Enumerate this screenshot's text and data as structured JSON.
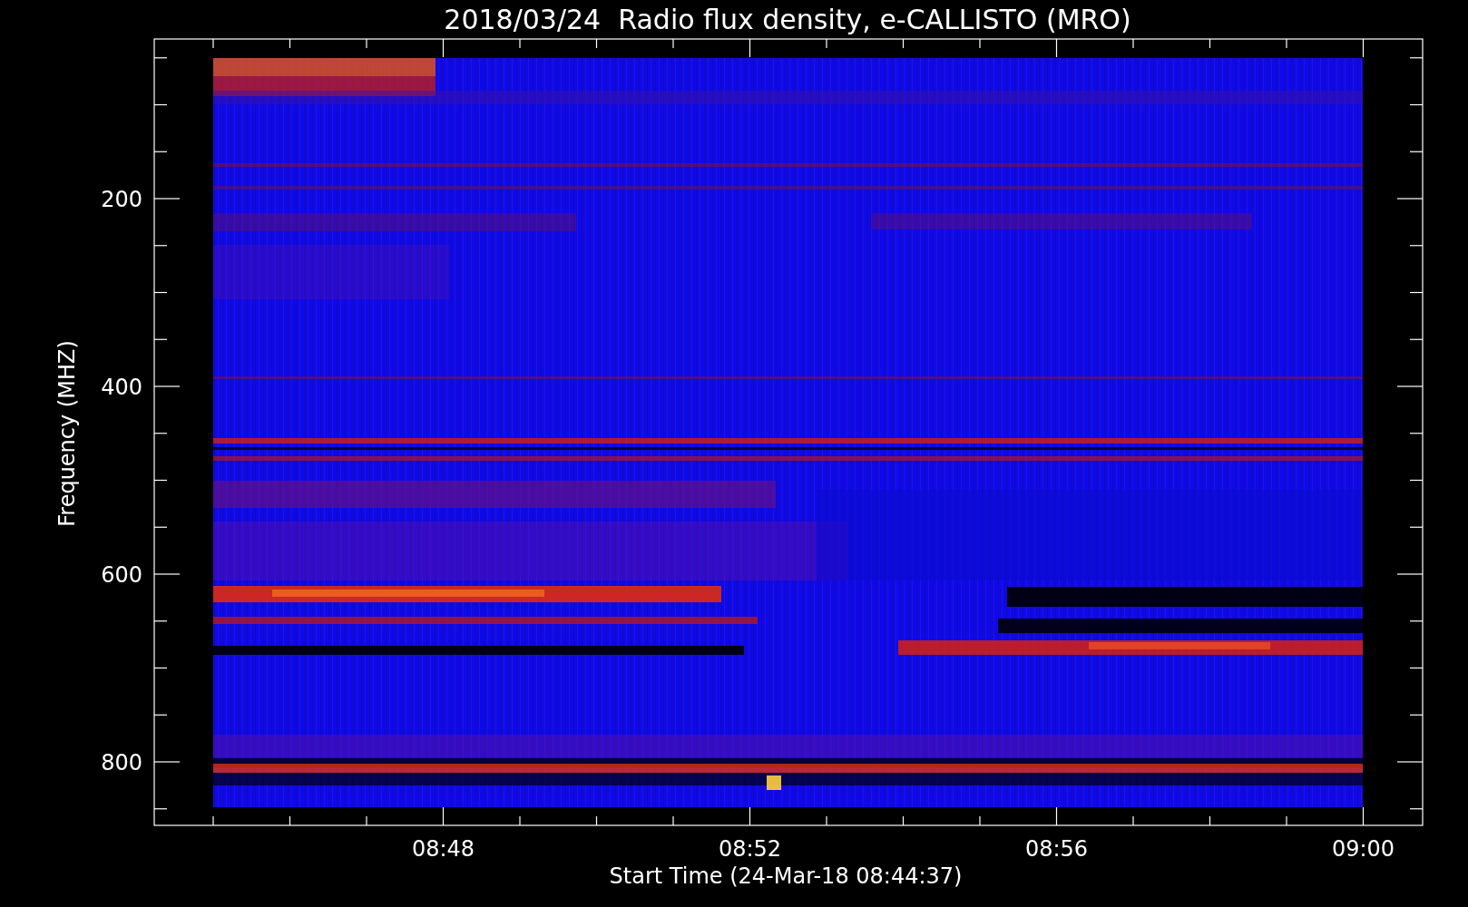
{
  "title": "2018/03/24  Radio flux density, e-CALLISTO (MRO)",
  "y_axis": {
    "label": "Frequency (MHZ)",
    "ticks": [
      "200",
      "400",
      "600",
      "800"
    ]
  },
  "x_axis": {
    "label": "Start Time (24-Mar-18 08:44:37)",
    "ticks": [
      "08:48",
      "08:52",
      "08:56",
      "09:00"
    ]
  }
}
